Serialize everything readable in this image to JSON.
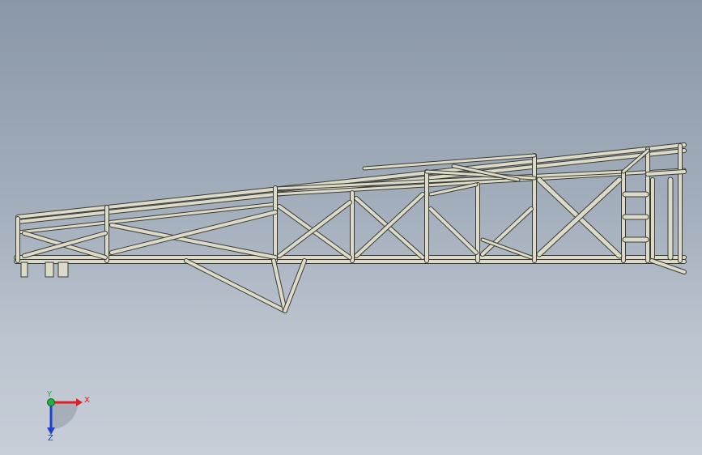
{
  "viewport": {
    "background_top": "#8a97a8",
    "background_bottom": "#c7ced8",
    "model": "truss-frame-assembly"
  },
  "triad": {
    "x_label": "X",
    "y_label": "Y",
    "z_label": "Z",
    "x_color": "#e02020",
    "y_color": "#20b040",
    "z_color": "#2040d0"
  },
  "colors": {
    "tube_fill": "#dcdac8",
    "tube_outline": "#3a3a32"
  }
}
